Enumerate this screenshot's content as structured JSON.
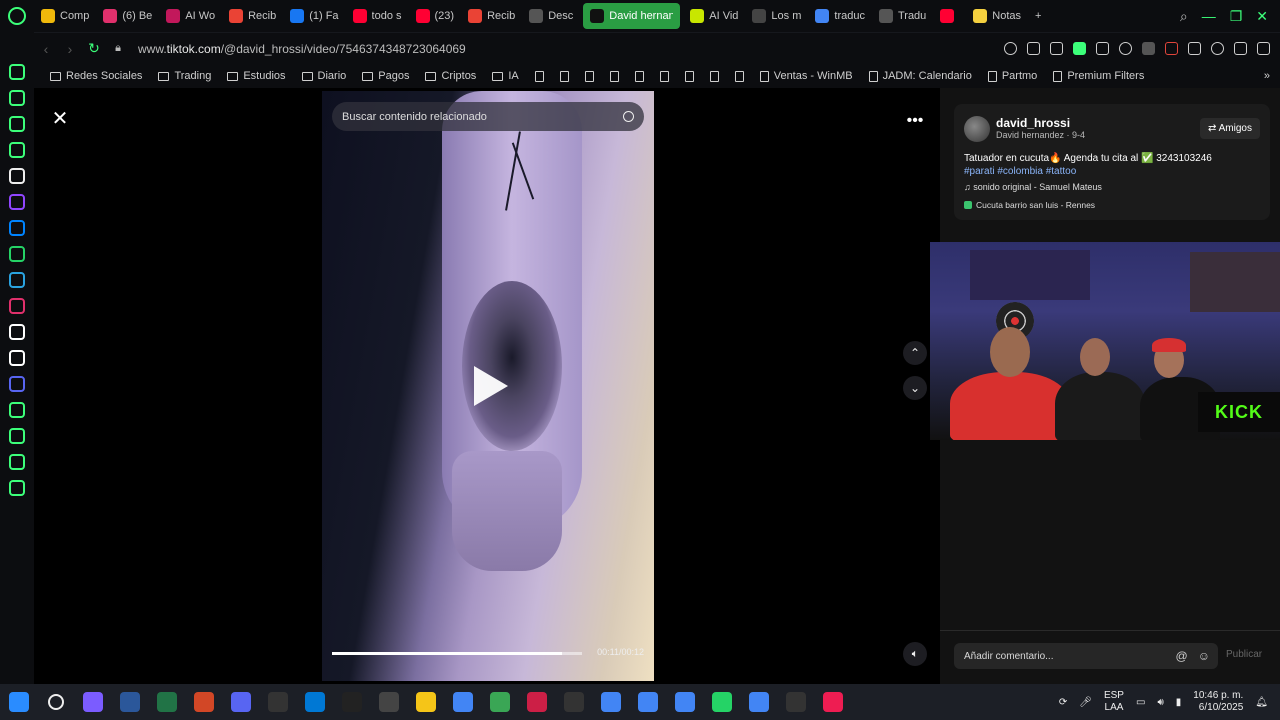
{
  "tabs": [
    {
      "label": "Comp",
      "icon": "binance-icon",
      "color": "#f0b90b",
      "active": false
    },
    {
      "label": "(6) Be",
      "icon": "instagram-icon",
      "color": "#e1306c",
      "active": false
    },
    {
      "label": "AI Wo",
      "icon": "ai-icon",
      "color": "#c2185b",
      "active": false
    },
    {
      "label": "Recib",
      "icon": "gmail-icon",
      "color": "#ea4335",
      "active": false
    },
    {
      "label": "(1) Fa",
      "icon": "facebook-icon",
      "color": "#1877f2",
      "active": false
    },
    {
      "label": "todo s",
      "icon": "youtube-icon",
      "color": "#ff0033",
      "active": false
    },
    {
      "label": "(23)",
      "icon": "youtube-icon",
      "color": "#ff0033",
      "active": false
    },
    {
      "label": "Recib",
      "icon": "gmail-icon",
      "color": "#ea4335",
      "active": false
    },
    {
      "label": "Desc",
      "icon": "chatgpt-icon",
      "color": "#555555",
      "active": false
    },
    {
      "label": "David hernan",
      "icon": "tiktok-icon",
      "color": "#111111",
      "active": true
    },
    {
      "label": "AI Vid",
      "icon": "ai-video-icon",
      "color": "#c8e600",
      "active": false
    },
    {
      "label": "Los m",
      "icon": "perplexity-icon",
      "color": "#444444",
      "active": false
    },
    {
      "label": "traduc",
      "icon": "google-icon",
      "color": "#4285f4",
      "active": false
    },
    {
      "label": "Tradu",
      "icon": "chatgpt-icon",
      "color": "#555555",
      "active": false
    },
    {
      "label": "",
      "icon": "youtube-muted-icon",
      "color": "#ff0033",
      "active": false
    },
    {
      "label": "Notas",
      "icon": "notes-icon",
      "color": "#f4d03f",
      "active": false
    }
  ],
  "sidebar": [
    {
      "icon": "refresh-circle-icon",
      "color": "#3cff7a"
    },
    {
      "icon": "workspace-icon",
      "color": "#3cff7a"
    },
    {
      "icon": "layers-icon",
      "color": "#3cff7a"
    },
    {
      "icon": "gx-icon",
      "color": "#3cff7a"
    },
    {
      "icon": "aria-icon",
      "color": "#eeeeee"
    },
    {
      "icon": "twitch-icon",
      "color": "#9146ff"
    },
    {
      "icon": "messenger-icon",
      "color": "#0084ff"
    },
    {
      "icon": "whatsapp-icon",
      "color": "#25d366"
    },
    {
      "icon": "telegram-icon",
      "color": "#2aa3e0"
    },
    {
      "icon": "instagram-icon",
      "color": "#e1306c"
    },
    {
      "icon": "tiktok-icon",
      "color": "#ffffff"
    },
    {
      "icon": "x-icon",
      "color": "#ffffff"
    },
    {
      "icon": "discord-icon",
      "color": "#5865f2"
    },
    {
      "icon": "player-icon",
      "color": "#3cff7a"
    },
    {
      "icon": "history-icon",
      "color": "#3cff7a"
    },
    {
      "icon": "extensions-icon",
      "color": "#3cff7a"
    },
    {
      "icon": "settings-icon",
      "color": "#3cff7a"
    }
  ],
  "address_bar": {
    "url_domain_prefix": "www.",
    "url_domain": "tiktok.com",
    "url_path": "/@david_hrossi/video/7546374348723064069"
  },
  "bookmarks": [
    {
      "label": "Redes Sociales",
      "type": "folder"
    },
    {
      "label": "Trading",
      "type": "folder"
    },
    {
      "label": "Estudios",
      "type": "folder"
    },
    {
      "label": "Diario",
      "type": "folder"
    },
    {
      "label": "Pagos",
      "type": "folder"
    },
    {
      "label": "Criptos",
      "type": "folder"
    },
    {
      "label": "IA",
      "type": "folder"
    },
    {
      "label": "",
      "type": "page"
    },
    {
      "label": "",
      "type": "page"
    },
    {
      "label": "",
      "type": "page"
    },
    {
      "label": "",
      "type": "page"
    },
    {
      "label": "",
      "type": "page"
    },
    {
      "label": "",
      "type": "page"
    },
    {
      "label": "",
      "type": "page"
    },
    {
      "label": "",
      "type": "page"
    },
    {
      "label": "",
      "type": "page"
    },
    {
      "label": "Ventas - WinMB",
      "type": "page"
    },
    {
      "label": "JADM: Calendario",
      "type": "page"
    },
    {
      "label": "Partmo",
      "type": "page"
    },
    {
      "label": "Premium Filters",
      "type": "page"
    }
  ],
  "video": {
    "search_placeholder": "Buscar contenido relacionado",
    "time_display": "00:11/00:12",
    "progress": 0.92
  },
  "creator": {
    "username": "david_hrossi",
    "subtitle": "David hernandez · 9-4",
    "friends_label": "Amigos",
    "description": "Tatuador en cucuta🔥 Agenda tu cita al ✅ 3243103246",
    "hashtags": "#parati #colombia #tattoo",
    "music": "sonido original - Samuel Mateus",
    "location": "Cucuta barrio san luis - Rennes"
  },
  "webcam": {
    "logo_text": "KICK"
  },
  "comments": {
    "placeholder": "Añadir comentario...",
    "publish_label": "Publicar"
  },
  "taskbar": {
    "apps": [
      {
        "icon": "windows-start-icon",
        "color": "#2a8cff"
      },
      {
        "icon": "search-icon",
        "color": "#1c1f26"
      },
      {
        "icon": "copilot-icon",
        "color": "#7b5cff"
      },
      {
        "icon": "word-icon",
        "color": "#2b579a"
      },
      {
        "icon": "excel-icon",
        "color": "#217346"
      },
      {
        "icon": "powerpoint-icon",
        "color": "#d24726"
      },
      {
        "icon": "discord-icon",
        "color": "#5865f2"
      },
      {
        "icon": "capcut-icon",
        "color": "#333333"
      },
      {
        "icon": "outlook-icon",
        "color": "#0078d4"
      },
      {
        "icon": "tradingview-icon",
        "color": "#222222"
      },
      {
        "icon": "steam-icon",
        "color": "#444444"
      },
      {
        "icon": "file-explorer-icon",
        "color": "#f5c518"
      },
      {
        "icon": "chrome-icon",
        "color": "#4285f4"
      },
      {
        "icon": "recycle-icon",
        "color": "#3aa655"
      },
      {
        "icon": "opera-gx-icon",
        "color": "#cc1f46"
      },
      {
        "icon": "chatgpt-icon",
        "color": "#333333"
      },
      {
        "icon": "chrome-profile-icon",
        "color": "#4285f4"
      },
      {
        "icon": "chrome-profile-icon",
        "color": "#4285f4"
      },
      {
        "icon": "chrome-profile-icon",
        "color": "#4285f4"
      },
      {
        "icon": "whatsapp-icon",
        "color": "#25d366"
      },
      {
        "icon": "chrome-profile-icon",
        "color": "#4285f4"
      },
      {
        "icon": "capcut-icon",
        "color": "#333333"
      },
      {
        "icon": "tiktok-icon",
        "color": "#ee1d52"
      }
    ],
    "lang": "ESP",
    "layout": "LAA",
    "time": "10:46 p. m.",
    "date": "6/10/2025"
  }
}
